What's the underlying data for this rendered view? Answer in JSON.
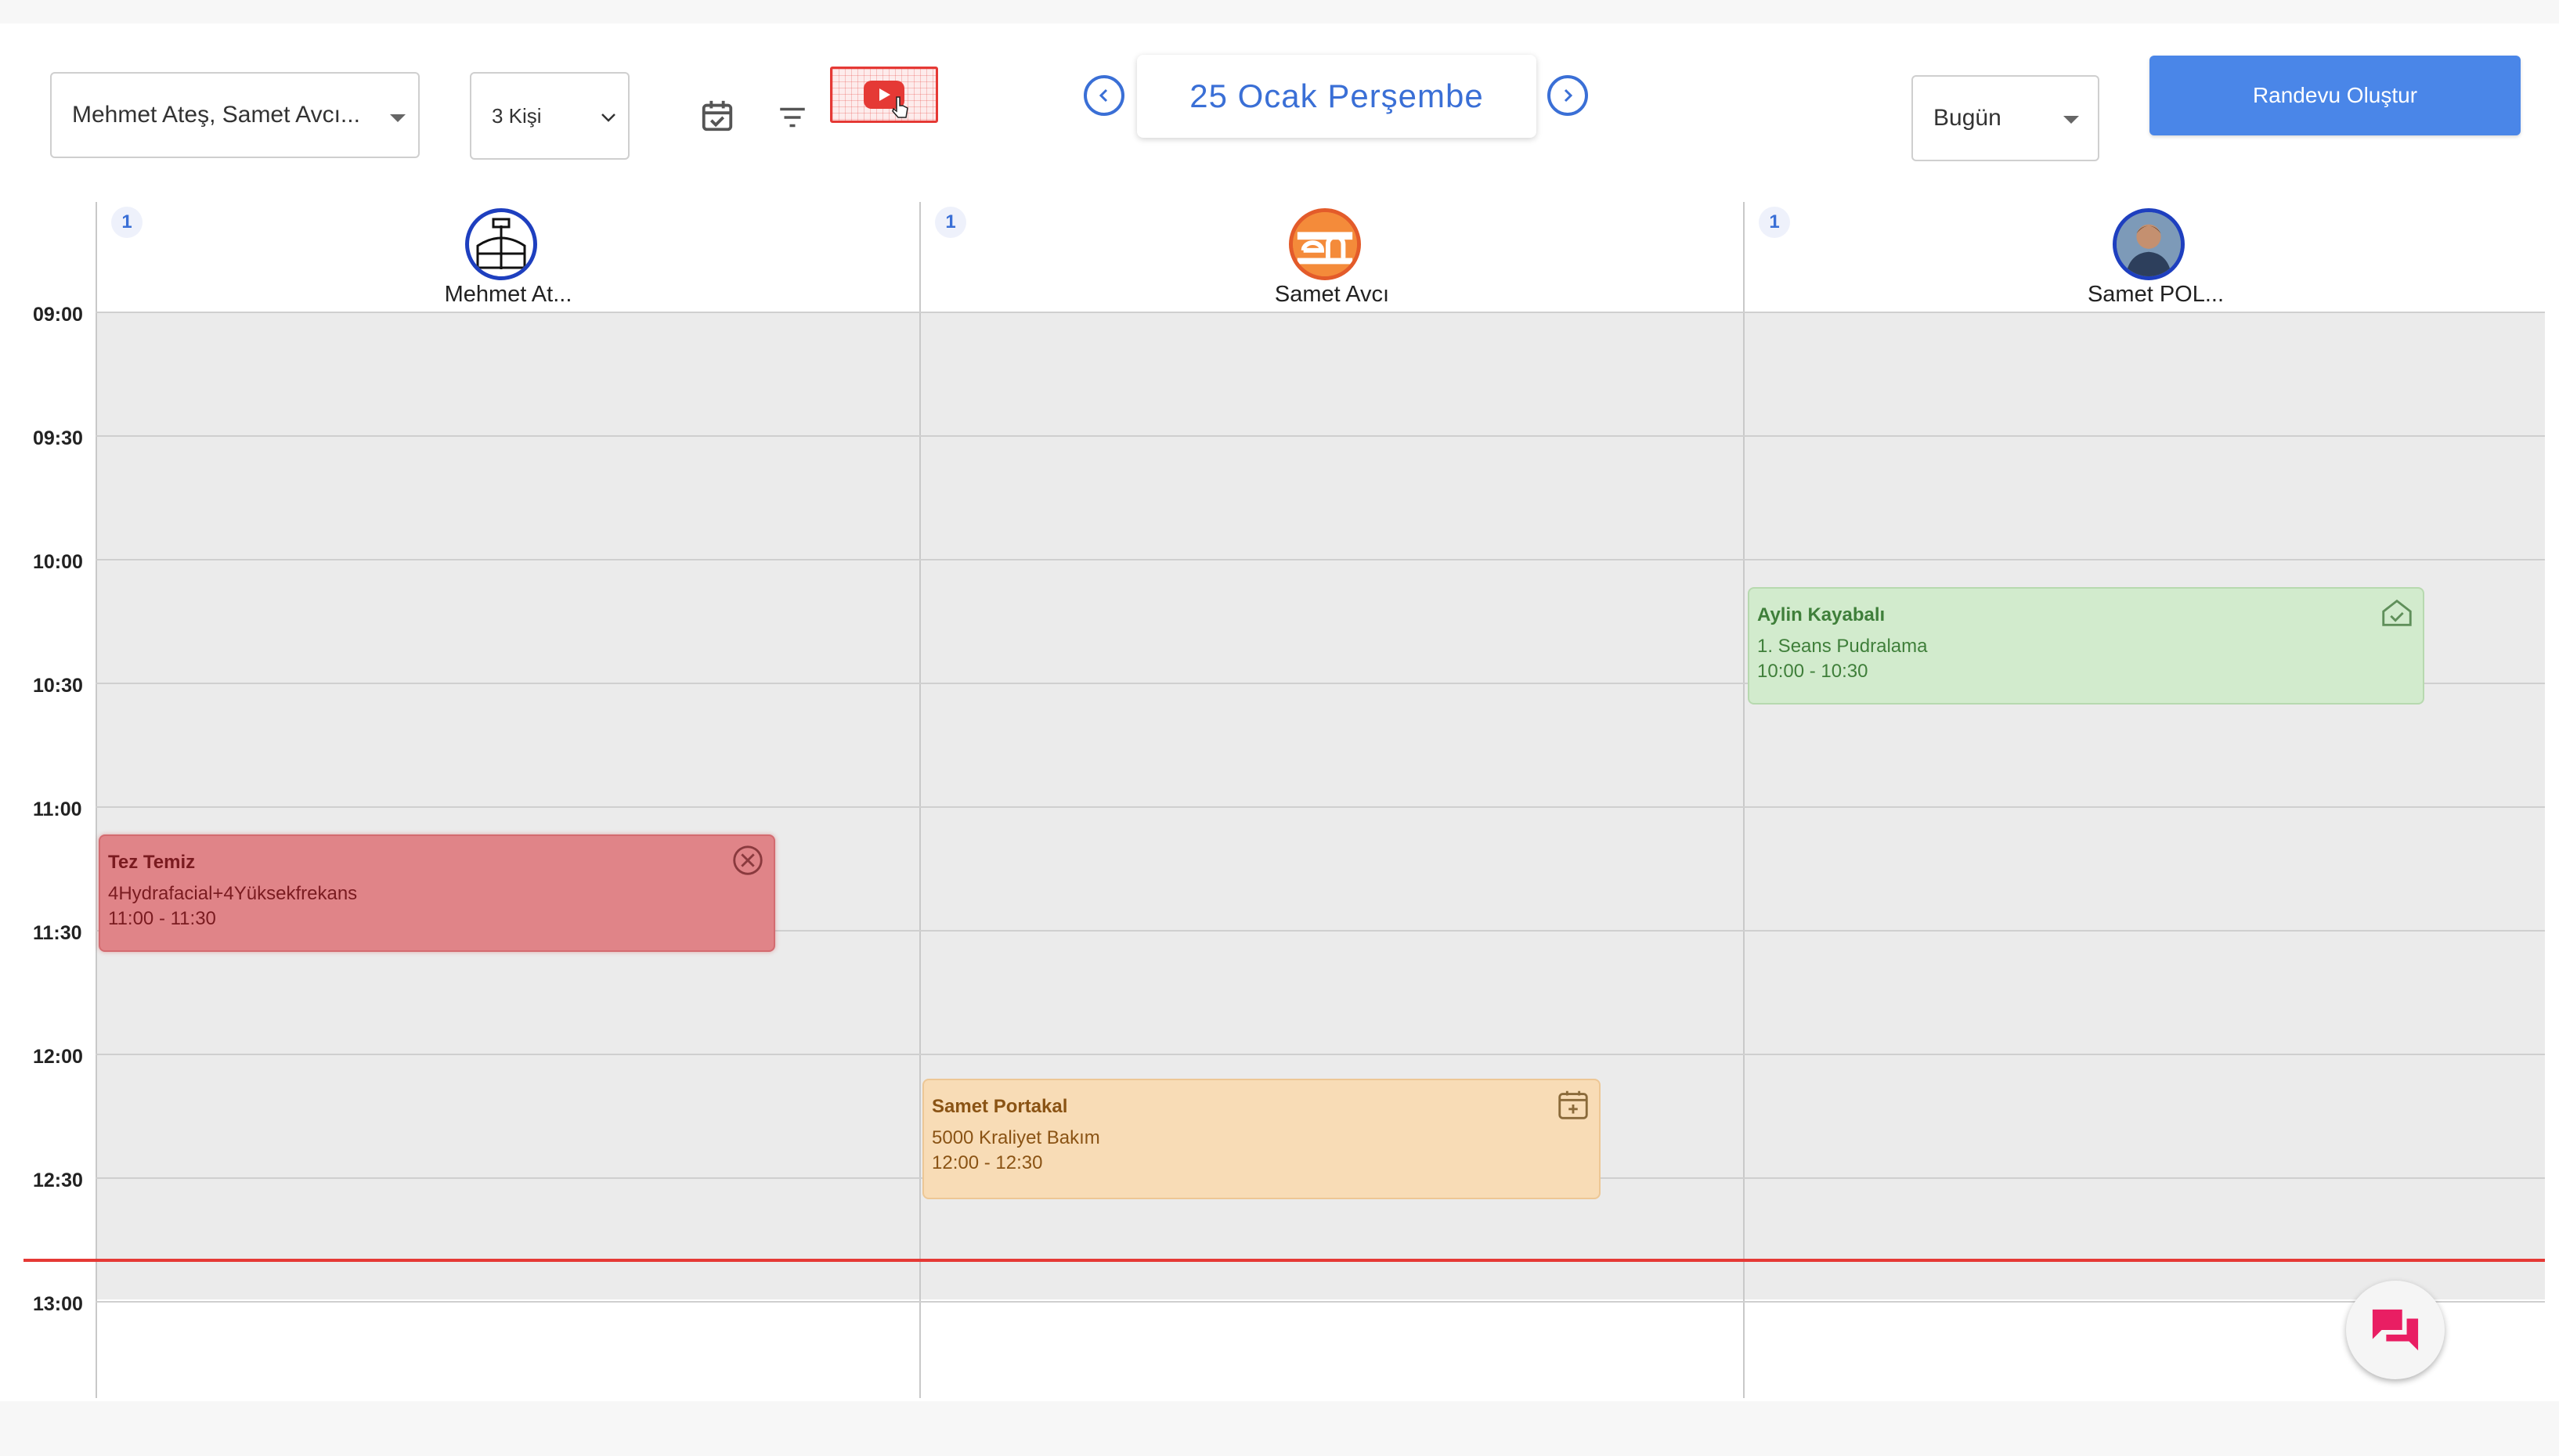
{
  "toolbar": {
    "staff_select_value": "Mehmet Ateş, Samet Avcı...",
    "people_select_value": "3 Kişi",
    "date_label": "25 Ocak Perşembe",
    "range_select_value": "Bugün",
    "create_button_label": "Randevu Oluştur",
    "icons": [
      "calendar-check-icon",
      "filter-icon",
      "youtube-icon",
      "chevron-left-icon",
      "chevron-right-icon"
    ]
  },
  "staff": [
    {
      "name": "Mehmet At...",
      "count": "1",
      "avatar": "logo-avatar-blue"
    },
    {
      "name": "Samet Avcı",
      "count": "1",
      "avatar": "logo-avatar-orange"
    },
    {
      "name": "Samet POL...",
      "count": "1",
      "avatar": "photo-avatar"
    }
  ],
  "time_slots": [
    "09:00",
    "09:30",
    "10:00",
    "10:30",
    "11:00",
    "11:30",
    "12:00",
    "12:30",
    "13:00"
  ],
  "appointments": [
    {
      "customer": "Tez Temiz",
      "service": "4Hydrafacial+4Yüksekfrekans",
      "time": "11:00 - 11:30",
      "staff_index": 0,
      "status_icon": "cancel-circle-icon",
      "color": "#e08488"
    },
    {
      "customer": "Aylin Kayabalı",
      "service": "1. Seans Pudralama",
      "time": "10:00 - 10:30",
      "staff_index": 2,
      "status_icon": "home-check-icon",
      "color": "#d2ebcd"
    },
    {
      "customer": "Samet Portakal",
      "service": "5000 Kraliyet Bakım",
      "time": "12:00 - 12:30",
      "staff_index": 1,
      "status_icon": "calendar-plus-icon",
      "color": "#f8dcb6"
    }
  ],
  "colors": {
    "accent": "#3a6fd6",
    "primary_button": "#4a86e8",
    "now_line": "#e53935",
    "chat_icon": "#e91e63"
  }
}
